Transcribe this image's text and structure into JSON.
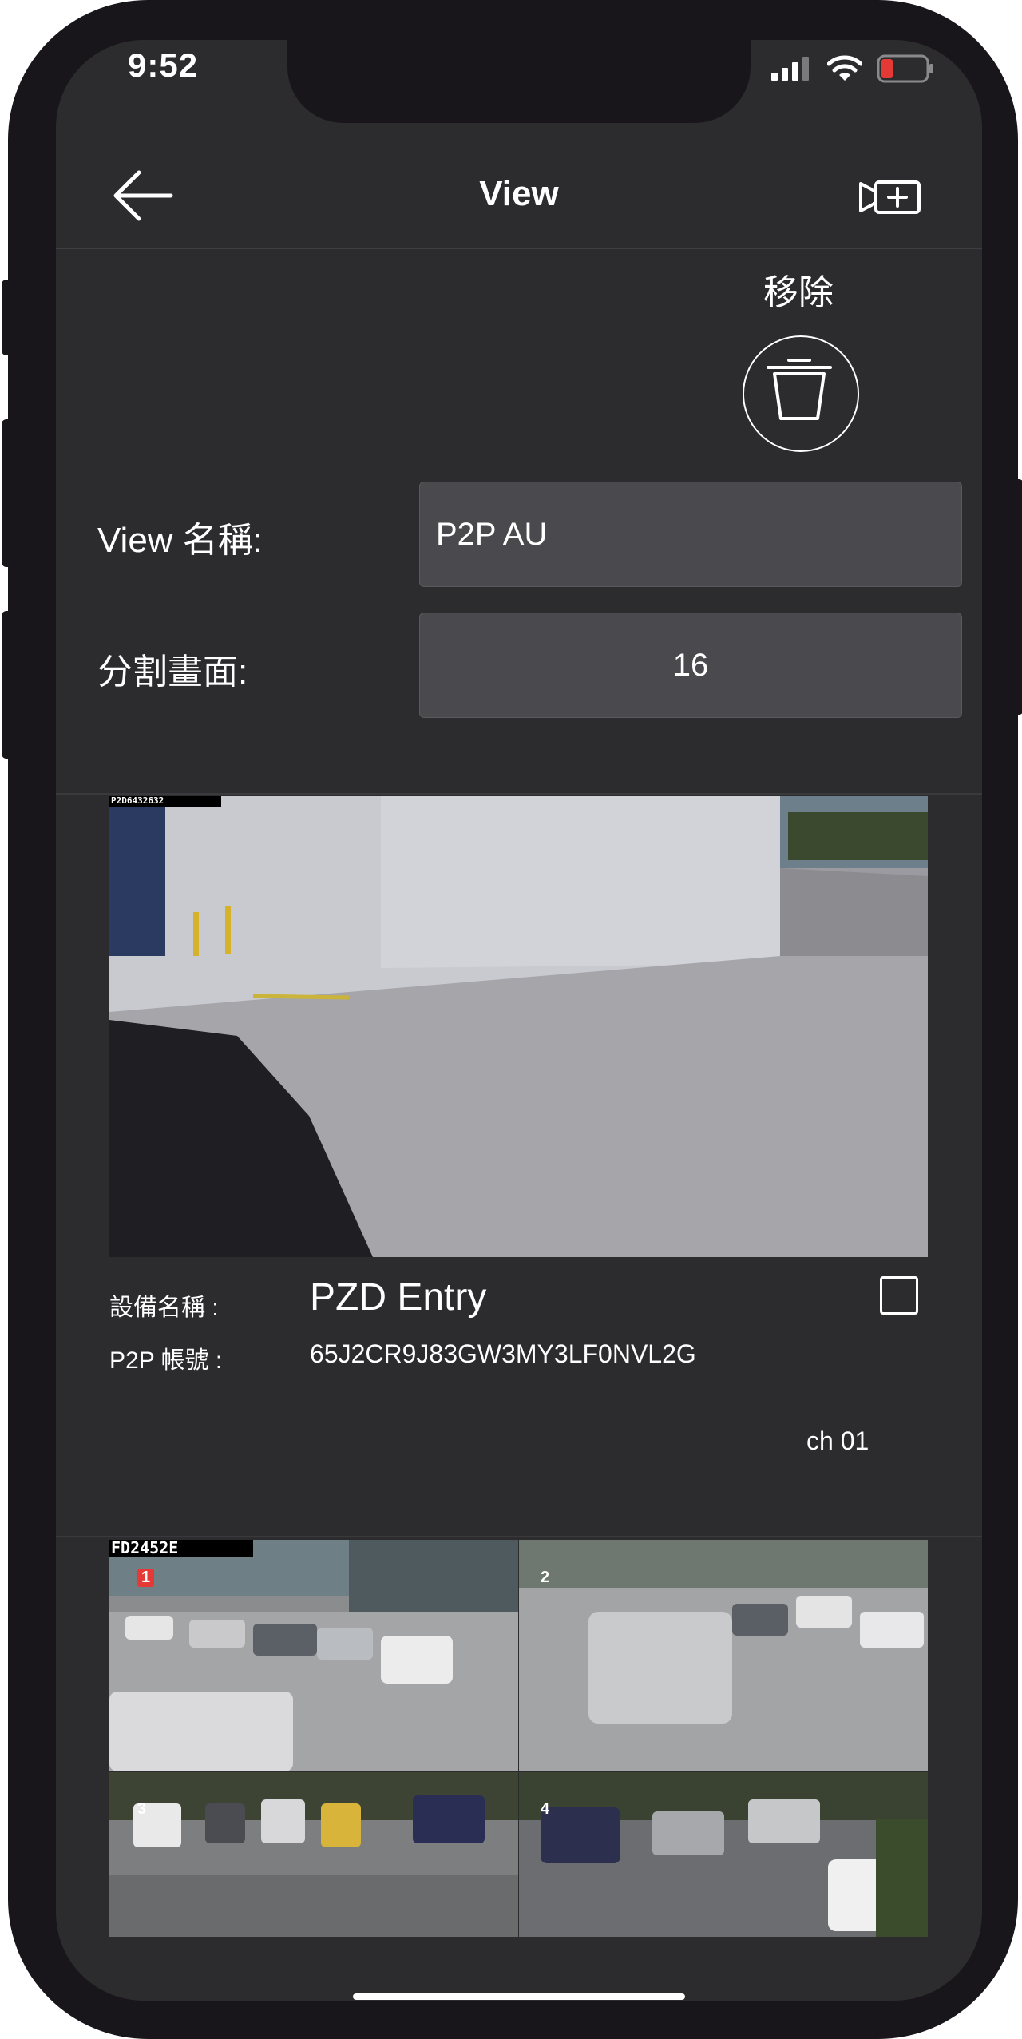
{
  "status_bar": {
    "time": "9:52"
  },
  "nav": {
    "title": "View"
  },
  "remove": {
    "label": "移除"
  },
  "form": {
    "name_label": "View 名稱:",
    "name_value": "P2P AU",
    "split_label": "分割畫面:",
    "split_value": "16"
  },
  "devices": [
    {
      "overlay_id": "P2D6432632",
      "name_label": "設備名稱 :",
      "name": "PZD Entry",
      "p2p_label": "P2P 帳號 :",
      "p2p_id": "65J2CR9J83GW3MY3LF0NVL2G",
      "channel": "ch 01",
      "selected": false
    },
    {
      "overlay_id": "FD2452E",
      "channels": [
        "1",
        "2",
        "3",
        "4"
      ]
    }
  ],
  "icons": {
    "back": "arrow-left-icon",
    "add": "video-add-icon",
    "trash": "trash-icon",
    "signal": "signal-icon",
    "wifi": "wifi-icon",
    "battery": "battery-icon"
  },
  "colors": {
    "screen_bg": "#2c2b2e",
    "input_bg": "#4a494d",
    "battery_low": "#e53935"
  }
}
